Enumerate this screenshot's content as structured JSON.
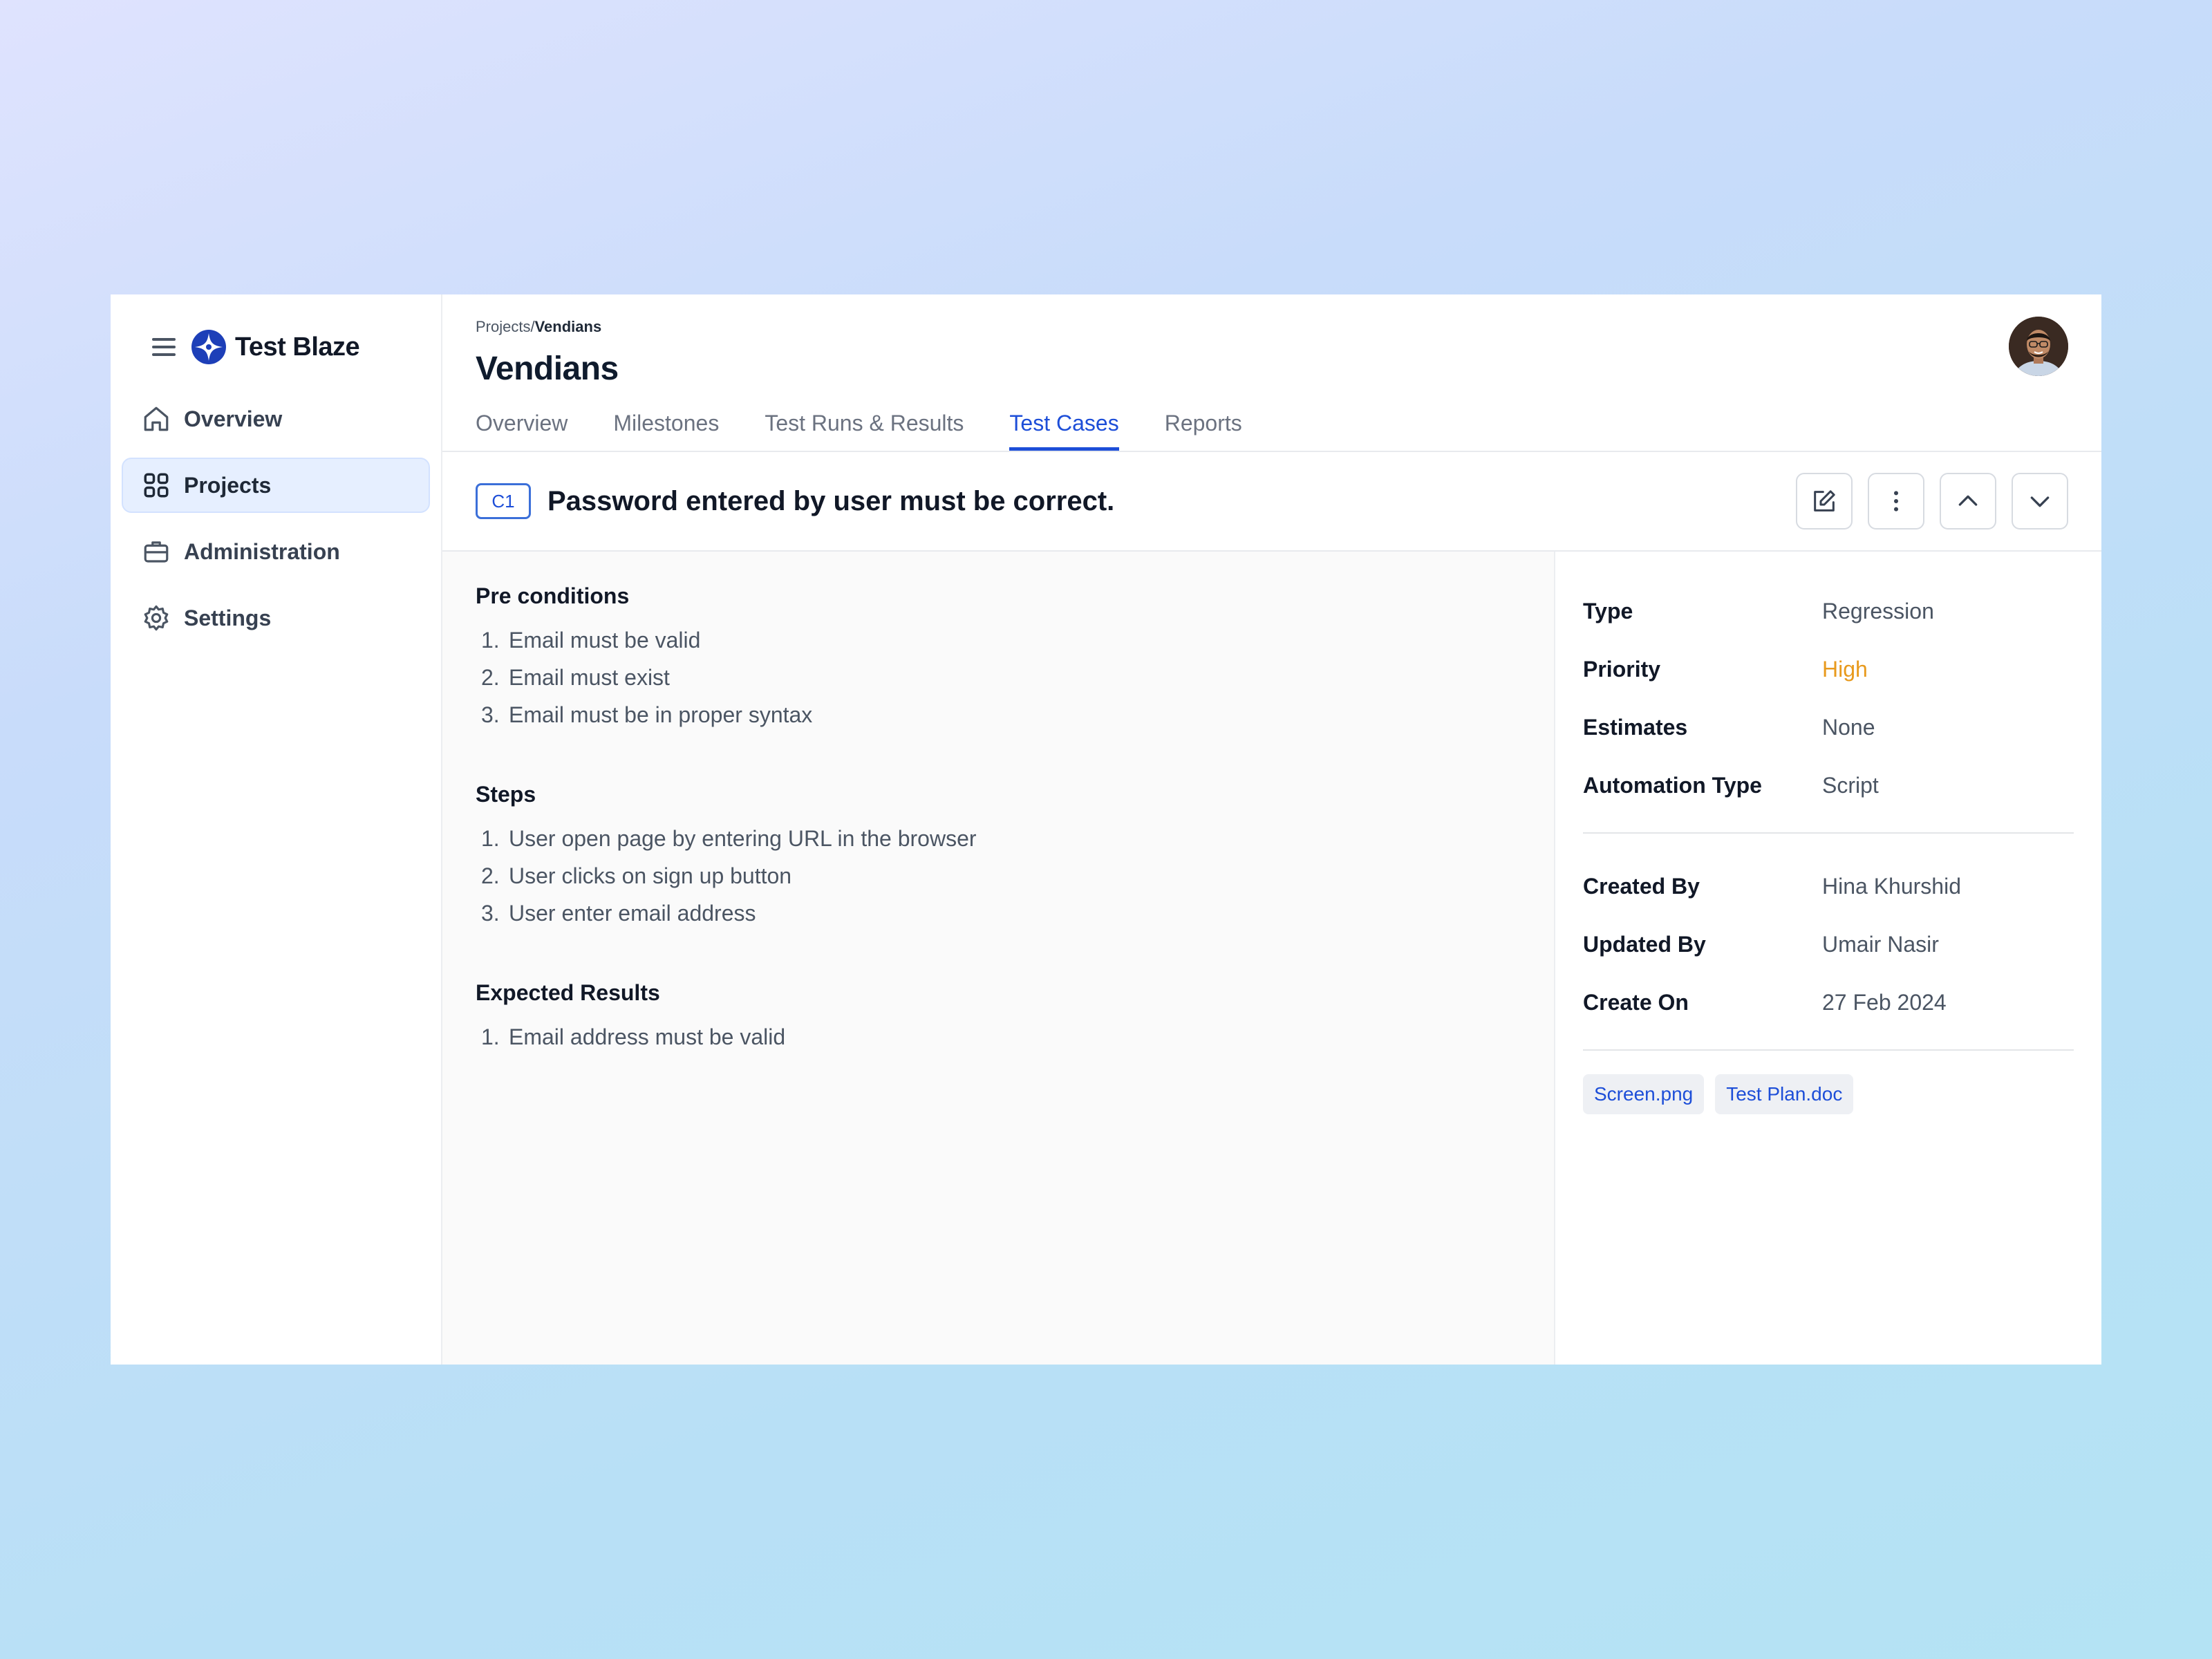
{
  "brand": {
    "name": "Test Blaze",
    "logo_color": "#1d3fb8"
  },
  "sidebar": {
    "items": [
      {
        "label": "Overview",
        "icon": "home-icon",
        "active": false
      },
      {
        "label": "Projects",
        "icon": "grid-icon",
        "active": true
      },
      {
        "label": "Administration",
        "icon": "briefcase-icon",
        "active": false
      },
      {
        "label": "Settings",
        "icon": "gear-icon",
        "active": false
      }
    ]
  },
  "header": {
    "breadcrumb_root": "Projects/",
    "breadcrumb_current": "Vendians",
    "title": "Vendians",
    "tabs": [
      {
        "label": "Overview",
        "active": false
      },
      {
        "label": "Milestones",
        "active": false
      },
      {
        "label": "Test Runs & Results",
        "active": false
      },
      {
        "label": "Test Cases",
        "active": true
      },
      {
        "label": "Reports",
        "active": false
      }
    ]
  },
  "test_case": {
    "id": "C1",
    "title": "Password entered by user must be correct."
  },
  "sections": {
    "preconditions": {
      "title": "Pre conditions",
      "items": [
        "Email must be valid",
        "Email must exist",
        "Email must be in proper syntax"
      ]
    },
    "steps": {
      "title": "Steps",
      "items": [
        "User open page by entering URL in the browser",
        "User clicks on sign up button",
        "User enter email address"
      ]
    },
    "expected": {
      "title": "Expected Results",
      "items": [
        "Email address must be valid"
      ]
    }
  },
  "properties": {
    "type_label": "Type",
    "type_value": "Regression",
    "priority_label": "Priority",
    "priority_value": "High",
    "estimates_label": "Estimates",
    "estimates_value": "None",
    "automation_label": "Automation Type",
    "automation_value": "Script",
    "created_by_label": "Created By",
    "created_by_value": "Hina Khurshid",
    "updated_by_label": "Updated By",
    "updated_by_value": "Umair Nasir",
    "created_on_label": "Create On",
    "created_on_value": "27 Feb 2024"
  },
  "attachments": [
    "Screen.png",
    "Test Plan.doc"
  ],
  "colors": {
    "accent": "#1d4ed8",
    "priority_high": "#e89a1d",
    "active_nav_bg": "#e6efff"
  }
}
